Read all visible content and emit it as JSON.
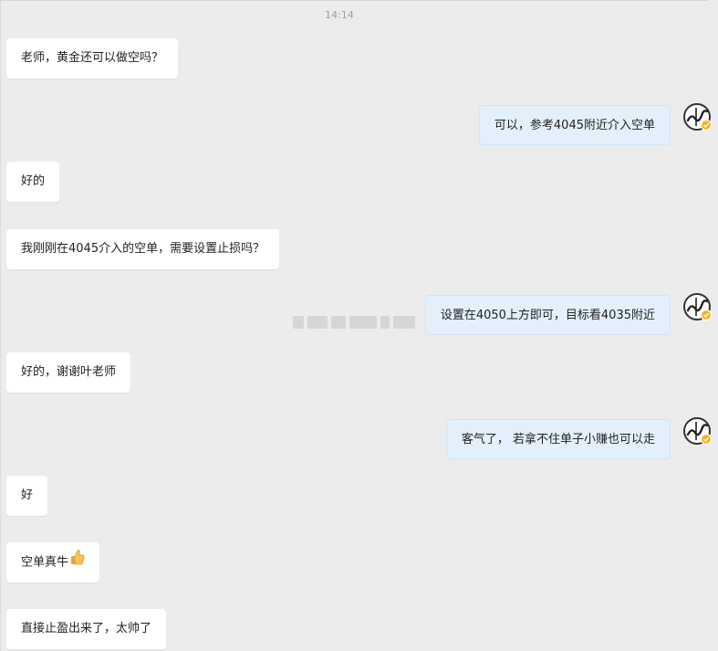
{
  "chat": {
    "timestamp": "14:14",
    "messages": [
      {
        "side": "in",
        "text": "老师，黄金还可以做空吗？"
      },
      {
        "side": "out",
        "text": "可以，参考4045附近介入空单"
      },
      {
        "side": "in",
        "text": "好的"
      },
      {
        "side": "in",
        "text": "我刚刚在4045介入的空单，需要设置止损吗？"
      },
      {
        "side": "out",
        "text": "设置在4050上方即可，目标看4035附近"
      },
      {
        "side": "in",
        "text": "好的，谢谢叶老师"
      },
      {
        "side": "out",
        "text": "客气了， 若拿不住单子小赚也可以走"
      },
      {
        "side": "in",
        "text": "好"
      },
      {
        "side": "in",
        "text": "空单真牛",
        "icon": "thumbs-up-icon"
      },
      {
        "side": "in",
        "text": "直接止盈出来了，太帅了"
      }
    ]
  },
  "colors": {
    "background": "#ececec",
    "incoming_bubble": "#ffffff",
    "outgoing_bubble": "#e3effa",
    "badge": "#f5b41c"
  }
}
